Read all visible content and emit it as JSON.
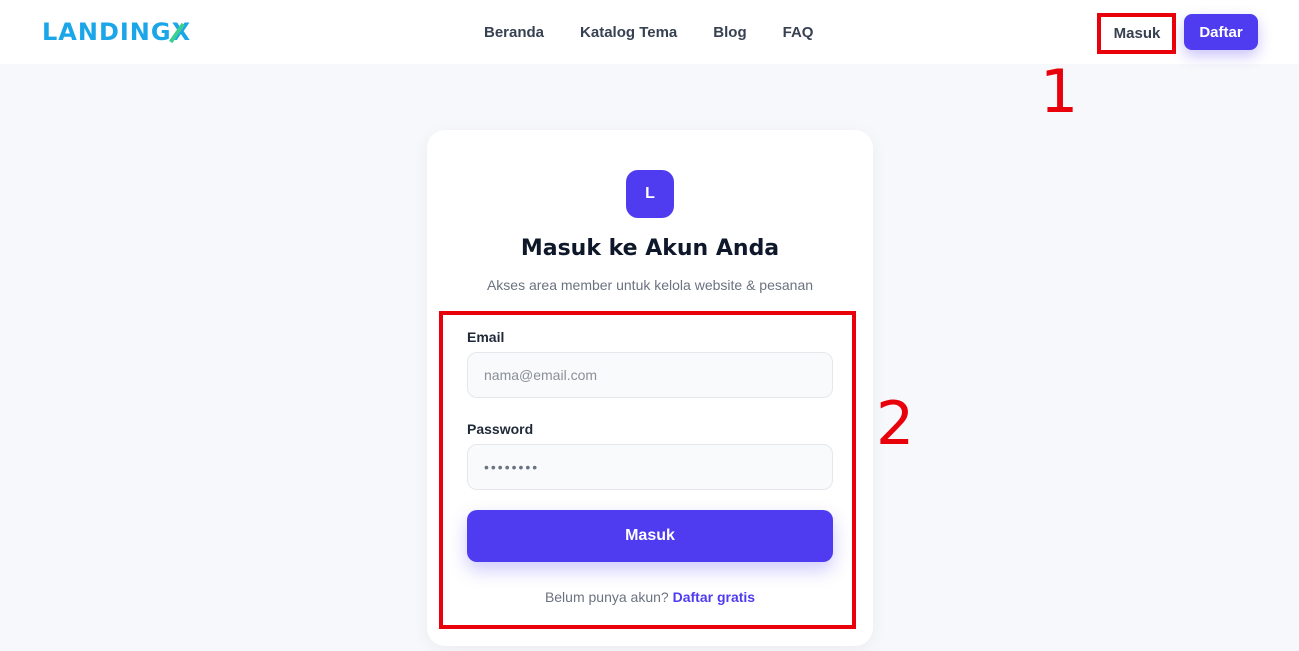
{
  "header": {
    "logo_text": "LANDING",
    "logo_accent": "X",
    "nav": [
      "Beranda",
      "Katalog Tema",
      "Blog",
      "FAQ"
    ],
    "login_label": "Masuk",
    "register_label": "Daftar"
  },
  "card": {
    "avatar_letter": "L",
    "title": "Masuk ke Akun Anda",
    "subtitle": "Akses area member untuk kelola website & pesanan",
    "email_label": "Email",
    "email_placeholder": "nama@email.com",
    "password_label": "Password",
    "password_value": "••••••••",
    "submit_label": "Masuk",
    "signup_text": "Belum punya akun?",
    "signup_link": "Daftar gratis"
  },
  "annotations": {
    "one": "1",
    "two": "2"
  },
  "colors": {
    "primary": "#4f3cf0",
    "logo": "#1aa6e8",
    "annotation": "#e8000b"
  }
}
